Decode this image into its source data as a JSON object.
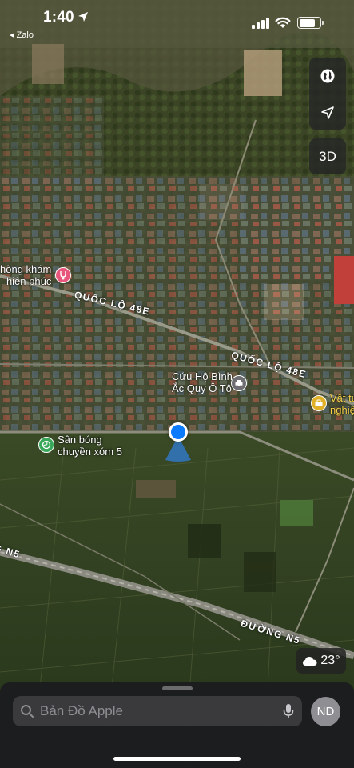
{
  "status_bar": {
    "time": "1:40",
    "back_app": "◂ Zalo"
  },
  "map": {
    "controls": {
      "map_mode_icon": "globe-icon",
      "location_icon": "location-arrow-icon",
      "three_d_label": "3D"
    },
    "road_labels": {
      "ql48e_1": "QUỐC LỘ 48E",
      "ql48e_2": "QUỐC LỘ 48E",
      "n5_right": "ĐƯỜNG N5",
      "n5_left": "G N5"
    },
    "pois": {
      "clinic": {
        "line1": "hòng khám",
        "line2": "hiện phúc",
        "icon": "stethoscope-icon",
        "color": "#e8577b"
      },
      "rescue": {
        "line1": "Cứu Hộ Bình",
        "line2": "Ắc Quy Ô Tô",
        "icon": "car-icon",
        "color": "#6e6e73"
      },
      "materials": {
        "line1": "Vật tư",
        "line2": "nghiệ",
        "icon": "briefcase-icon",
        "color": "#e0b128"
      },
      "court": {
        "line1": "Sân bóng",
        "line2": "chuyền xóm 5",
        "icon": "volleyball-icon",
        "color": "#39a85a"
      }
    }
  },
  "weather": {
    "icon": "cloud-icon",
    "temperature": "23°"
  },
  "search": {
    "placeholder": "Bản Đồ Apple"
  },
  "profile": {
    "initials": "ND"
  },
  "colors": {
    "user_location": "#0a7aff",
    "sheet_background": "#1c1c1e"
  }
}
